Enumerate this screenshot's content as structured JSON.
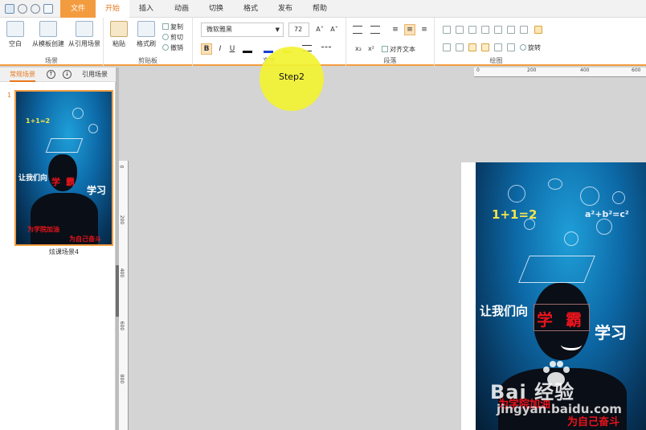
{
  "menubar": {
    "tabs": [
      "文件",
      "开始",
      "插入",
      "动画",
      "切换",
      "格式",
      "发布",
      "帮助"
    ],
    "active_tab": "开始"
  },
  "ribbon": {
    "scene_group": {
      "label": "场景",
      "buttons": [
        "空白",
        "从模板创建",
        "从引用场景"
      ]
    },
    "clipboard_group": {
      "label": "剪贴板",
      "paste": "粘贴",
      "format_painter": "格式刷",
      "copy": "复制",
      "cut": "剪切",
      "undo": "撤销"
    },
    "text_group": {
      "label": "文字",
      "font_name": "微软雅黑",
      "font_size": "72",
      "bold": "B",
      "italic": "I",
      "underline": "U",
      "grow": "A˄",
      "shrink": "A˅"
    },
    "paragraph_group": {
      "label": "段落",
      "align_text": "对齐文本"
    },
    "drawing_group": {
      "label": "绘图",
      "rotate": "旋转"
    }
  },
  "left_panel": {
    "tabs": [
      "常规场景",
      "引用场景"
    ],
    "active_tab": "常规场景",
    "up_icon": "↑",
    "down_icon": "↓",
    "thumbnail": {
      "number": "1",
      "label": "炫课场景4"
    }
  },
  "rulers": {
    "horizontal": [
      "0",
      "200",
      "400",
      "600"
    ],
    "vertical": [
      "0",
      "200",
      "400",
      "600",
      "800"
    ]
  },
  "poster": {
    "left_text": "让我们向",
    "head_left": "学",
    "head_right": "霸",
    "right_text": "学习",
    "formula": "1+1=2",
    "formula2": "a²+b²=c²",
    "bottom_left": "为学院加油",
    "bottom_right": "为自己奋斗"
  },
  "callout": {
    "text": "Step2"
  },
  "watermark": {
    "logo": "Bai 经验",
    "url": "jingyan.baidu.com"
  },
  "colors": {
    "accent": "#f39c3f",
    "accent_text": "#e8771d",
    "callout": "#f2f231",
    "poster_red": "#e8141c"
  }
}
